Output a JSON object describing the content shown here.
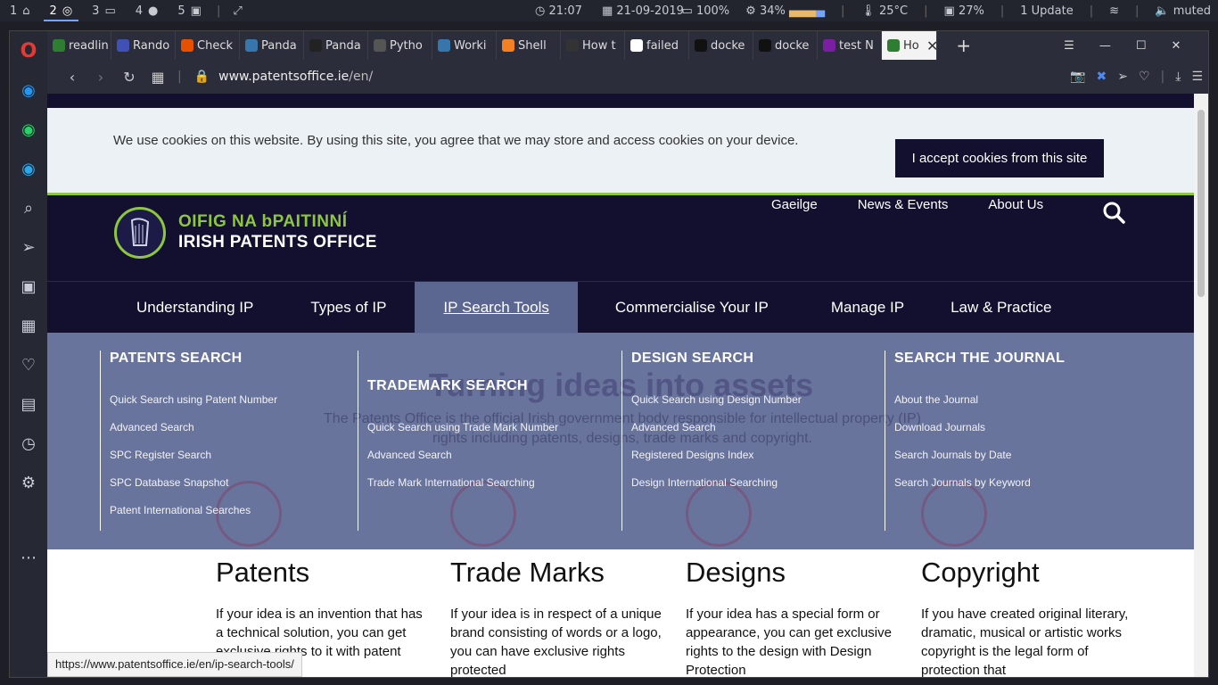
{
  "system_bar": {
    "workspaces": [
      {
        "num": "1",
        "icon": "home-icon"
      },
      {
        "num": "2",
        "icon": "chrome-icon",
        "active": true
      },
      {
        "num": "3",
        "icon": "folder-icon"
      },
      {
        "num": "4",
        "icon": "github-icon"
      },
      {
        "num": "5",
        "icon": "terminal-icon"
      }
    ],
    "time": "21:07",
    "date": "21-09-2019",
    "battery": "100%",
    "cpu": "34%",
    "temp": "25°C",
    "mem": "27%",
    "updates": "1 Update",
    "volume": "muted"
  },
  "tabs": [
    {
      "label": "readlin",
      "color": "#2e7d32"
    },
    {
      "label": "Rando",
      "color": "#3f51b5"
    },
    {
      "label": "Check",
      "color": "#e65100"
    },
    {
      "label": "Panda",
      "color": "#3776ab"
    },
    {
      "label": "Panda",
      "color": "#222222"
    },
    {
      "label": "Pytho",
      "color": "#555555"
    },
    {
      "label": "Worki",
      "color": "#3776ab"
    },
    {
      "label": "Shell",
      "color": "#f48024"
    },
    {
      "label": "How t",
      "color": "#333333"
    },
    {
      "label": "failed",
      "color": "#ffffff"
    },
    {
      "label": "docke",
      "color": "#111111"
    },
    {
      "label": "docke",
      "color": "#111111"
    },
    {
      "label": "test N",
      "color": "#7b1fa2"
    },
    {
      "label": "Ho",
      "color": "#2e7d32",
      "active": true
    }
  ],
  "address": {
    "host": "www.patentsoffice.ie",
    "path": "/en/"
  },
  "cookie": {
    "message": "We use cookies on this website. By using this site, you agree that we may store and access cookies on your device.",
    "accept": "I accept cookies from this site"
  },
  "header": {
    "logo_irish": "OIFIG NA bPAITINNÍ",
    "logo_english": "IRISH PATENTS OFFICE",
    "top_links": [
      "Gaeilge",
      "News & Events",
      "About Us"
    ]
  },
  "main_nav": [
    "Understanding IP",
    "Types of IP",
    "IP Search Tools",
    "Commercialise Your IP",
    "Manage IP",
    "Law & Practice"
  ],
  "hero": {
    "title": "Turning ideas into assets",
    "subtitle": "The Patents Office is the official Irish government body responsible for intellectual property (IP) rights including patents, designs, trade marks and copyright."
  },
  "mega_menu": [
    {
      "title": "PATENTS SEARCH",
      "items": [
        "Quick Search using Patent Number",
        "Advanced Search",
        "SPC Register Search",
        "SPC Database Snapshot",
        "Patent International Searches"
      ]
    },
    {
      "title": "TRADEMARK SEARCH",
      "items": [
        "Quick Search using Trade Mark Number",
        "Advanced Search",
        "Trade Mark International Searching"
      ]
    },
    {
      "title": "DESIGN SEARCH",
      "items": [
        "Quick Search using Design Number",
        "Advanced Search",
        "Registered Designs Index",
        "Design International Searching"
      ]
    },
    {
      "title": "SEARCH THE JOURNAL",
      "items": [
        "About the Journal",
        "Download Journals",
        "Search Journals by Date",
        "Search Journals by Keyword"
      ]
    }
  ],
  "cards": [
    {
      "title": "Patents",
      "text": "If your idea is an invention that has a technical solution, you can get exclusive rights to it with patent"
    },
    {
      "title": "Trade Marks",
      "text": "If your idea is in respect of a unique brand consisting of words or a logo, you can have exclusive rights protected"
    },
    {
      "title": "Designs",
      "text": "If your idea has a special form or appearance, you can get exclusive rights to the design with Design Protection"
    },
    {
      "title": "Copyright",
      "text": "If you have created original literary, dramatic, musical or artistic works copyright is the legal form of protection that"
    }
  ],
  "status_url": "https://www.patentsoffice.ie/en/ip-search-tools/"
}
